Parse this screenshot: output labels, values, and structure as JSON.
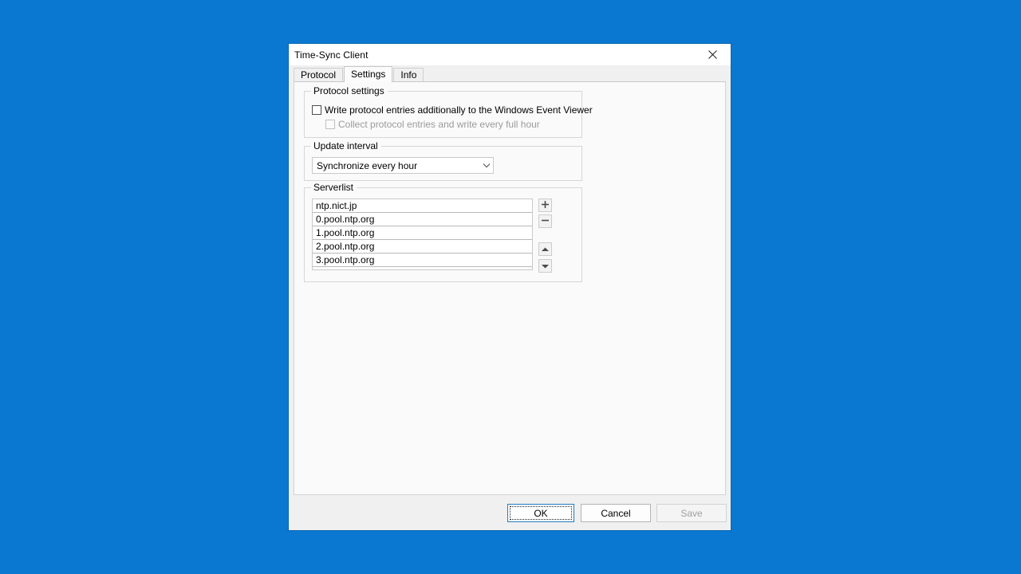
{
  "desktop": {
    "background_color": "#0a78d1"
  },
  "window": {
    "title": "Time-Sync Client",
    "close_icon": "close-icon",
    "border_color": "#0a64ad"
  },
  "tabs": [
    {
      "label": "Protocol",
      "active": false
    },
    {
      "label": "Settings",
      "active": true
    },
    {
      "label": "Info",
      "active": false
    }
  ],
  "protocol_settings": {
    "legend": "Protocol settings",
    "checkboxes": [
      {
        "label": "Write protocol entries additionally to the Windows Event Viewer",
        "checked": false,
        "enabled": true
      },
      {
        "label": "Collect protocol entries and write every full hour",
        "checked": false,
        "enabled": false
      }
    ]
  },
  "update_interval": {
    "legend": "Update interval",
    "dropdown": {
      "selected": "Synchronize every hour",
      "icon": "chevron-down-icon"
    }
  },
  "serverlist": {
    "legend": "Serverlist",
    "items": [
      "ntp.nict.jp",
      "0.pool.ntp.org",
      "1.pool.ntp.org",
      "2.pool.ntp.org",
      "3.pool.ntp.org"
    ],
    "buttons": [
      {
        "name": "add-server-button",
        "icon": "plus-icon"
      },
      {
        "name": "remove-server-button",
        "icon": "minus-icon"
      },
      {
        "name": "move-server-up-button",
        "icon": "arrow-up-icon"
      },
      {
        "name": "move-server-down-button",
        "icon": "arrow-down-icon"
      }
    ]
  },
  "footer": {
    "ok_label": "OK",
    "cancel_label": "Cancel",
    "save_label": "Save",
    "save_enabled": false,
    "focus_color": "#1f7bc1"
  }
}
